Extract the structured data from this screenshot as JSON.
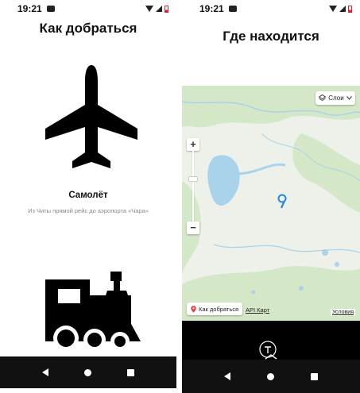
{
  "status_bar": {
    "time": "19:21"
  },
  "left_screen": {
    "title": "Как добраться",
    "plane_icon": "airplane-icon",
    "transport": {
      "name": "Самолёт",
      "description": "Из Читы прямой рейс до аэропорта «Чара»"
    },
    "train_icon": "train-icon"
  },
  "right_screen": {
    "title": "Где находится",
    "map": {
      "layers_label": "Слои",
      "zoom_in": "+",
      "zoom_out": "−",
      "route_button": "Как добраться",
      "api_link": "API Карт",
      "terms_link": "Условия"
    }
  },
  "colors": {
    "map_land": "#eef1ea",
    "map_forest": "#d4e8c8",
    "map_water": "#a9d3ea",
    "pin": "#1e88e5",
    "nav_bar": "#111111"
  }
}
